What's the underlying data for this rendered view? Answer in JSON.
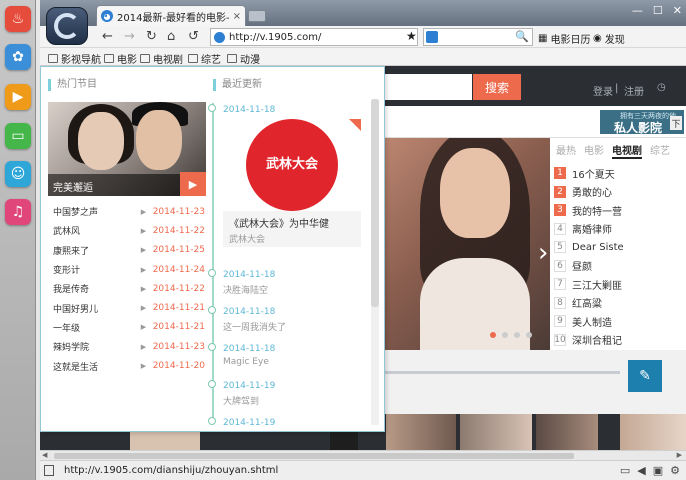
{
  "dock": [
    {
      "name": "fire-app-icon",
      "glyph": "♨",
      "color": "#e64c3c"
    },
    {
      "name": "film-reel-icon",
      "glyph": "✿",
      "color": "#3a8fd8"
    },
    {
      "name": "play-app-icon",
      "glyph": "▶",
      "color": "#f09a1a"
    },
    {
      "name": "tv-app-icon",
      "glyph": "▭",
      "color": "#45b649"
    },
    {
      "name": "bear-app-icon",
      "glyph": "☺",
      "color": "#2fa6d8"
    },
    {
      "name": "mic-app-icon",
      "glyph": "♫",
      "color": "#e0467a"
    }
  ],
  "browser": {
    "tab_title": "2014最新-最好看的电影-电视剧",
    "tab_close": "×",
    "window_controls": [
      "—",
      "☐",
      "✕"
    ],
    "url": "http://v.1905.com/",
    "nav": {
      "back": "←",
      "forward": "→",
      "refresh": "↻",
      "home": "⌂",
      "history": "↺"
    },
    "search_icon": "🔍",
    "extras": [
      {
        "label": "电影日历",
        "icon": "calendar-icon",
        "glyph": "▦"
      },
      {
        "label": "发现",
        "icon": "eye-icon",
        "glyph": "◉"
      }
    ],
    "bookmarks": [
      {
        "label": "影视导航",
        "name": "bookmark-film-nav"
      },
      {
        "label": "电影",
        "name": "bookmark-movie"
      },
      {
        "label": "电视剧",
        "name": "bookmark-tv"
      },
      {
        "label": "综艺",
        "name": "bookmark-variety"
      },
      {
        "label": "动漫",
        "name": "bookmark-anime"
      }
    ],
    "status_url": "http://v.1905.com/dianshiju/zhouyan.shtml",
    "status_icons": [
      "▭",
      "◀",
      "▣",
      "⚙"
    ]
  },
  "site": {
    "search_button": "搜索",
    "login": "登录",
    "separator": "|",
    "register": "注册",
    "history_glyph": "◷",
    "private_badge_small": "拥有三天两夜的他",
    "private_badge": "私人影院",
    "private_arrow": "下",
    "hero_text": "，",
    "hero_text2": "？",
    "fab_glyph": "✎",
    "rank_tabs": [
      "最热",
      "电影",
      "电视剧",
      "综艺"
    ],
    "rank_active_tab": "电视剧",
    "ranking": [
      {
        "num": "1",
        "title": "16个夏天",
        "tier": "hot"
      },
      {
        "num": "2",
        "title": "勇敢的心",
        "tier": "hot"
      },
      {
        "num": "3",
        "title": "我的特一营",
        "tier": "hot"
      },
      {
        "num": "4",
        "title": "离婚律师",
        "tier": "cold"
      },
      {
        "num": "5",
        "title": "Dear Siste",
        "tier": "cold"
      },
      {
        "num": "6",
        "title": "昼颜",
        "tier": "cold"
      },
      {
        "num": "7",
        "title": "三江大剿匪",
        "tier": "cold"
      },
      {
        "num": "8",
        "title": "红高粱",
        "tier": "cold"
      },
      {
        "num": "9",
        "title": "美人制造",
        "tier": "cold"
      },
      {
        "num": "10",
        "title": "深圳合租记",
        "tier": "cold"
      }
    ]
  },
  "panel": {
    "hot_heading": "热门节目",
    "latest_heading": "最近更新",
    "feature_caption": "完美邂逅",
    "feature_play": "▶",
    "shows": [
      {
        "title": "中国梦之声",
        "date": "2014-11-23"
      },
      {
        "title": "武林风",
        "date": "2014-11-22"
      },
      {
        "title": "康熙来了",
        "date": "2014-11-25"
      },
      {
        "title": "变形计",
        "date": "2014-11-24"
      },
      {
        "title": "我是传奇",
        "date": "2014-11-22"
      },
      {
        "title": "中国好男儿",
        "date": "2014-11-21"
      },
      {
        "title": "一年级",
        "date": "2014-11-21"
      },
      {
        "title": "辣妈学院",
        "date": "2014-11-23"
      },
      {
        "title": "这就是生活",
        "date": "2014-11-20"
      }
    ],
    "news": {
      "date": "2014-11-18",
      "poster_text": "武林大会",
      "title": "《武林大会》为中华健",
      "sub": "武林大会"
    },
    "timeline": [
      {
        "date": "2014-11-18",
        "title": "决胜海陆空"
      },
      {
        "date": "2014-11-18",
        "title": "这一周我消失了"
      },
      {
        "date": "2014-11-18",
        "title": "Magic Eye"
      },
      {
        "date": "2014-11-19",
        "title": "大牌驾到"
      },
      {
        "date": "2014-11-19",
        "title": ""
      }
    ]
  }
}
